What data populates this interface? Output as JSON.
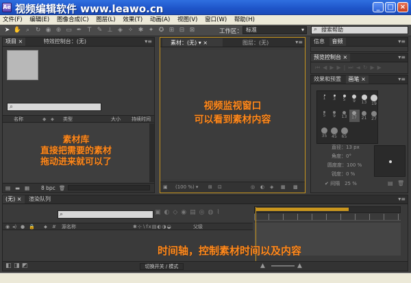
{
  "window": {
    "title": "视频编辑软件 www.leawo.cn",
    "icon_text": "Ae",
    "controls": {
      "minimize": "_",
      "maximize": "□",
      "close": "×"
    }
  },
  "menu": [
    "文件(F)",
    "编辑(E)",
    "图像合成(C)",
    "图层(L)",
    "效果(T)",
    "动画(A)",
    "视图(V)",
    "窗口(W)",
    "帮助(H)"
  ],
  "toolbar": {
    "workspace_label": "工作区：",
    "workspace_value": "标准",
    "search_placeholder": "搜索帮助"
  },
  "project_panel": {
    "tabs": [
      "项目",
      "特效控制台：(无)"
    ],
    "columns": [
      "名称",
      "类型",
      "大小",
      "持续时间"
    ],
    "bpc": "8 bpc",
    "overlay": [
      "素材库",
      "直接把需要的素材",
      "拖动进来就可以了"
    ]
  },
  "viewer_panel": {
    "tabs": [
      "素材：(无)",
      "图层：(无)"
    ],
    "zoom": "(100 %)",
    "overlay": [
      "视频监视窗口",
      "可以看到素材内容"
    ]
  },
  "right_panels": {
    "top_tabs": [
      "信息",
      "音频"
    ],
    "preview_tab": "预览控制台",
    "effects_tabs": [
      "效果和预置",
      "画笔"
    ],
    "brush_sizes": [
      "1",
      "3",
      "5",
      "9",
      "13",
      "19",
      "5",
      "9",
      "13",
      "17",
      "21",
      "27",
      "35",
      "45",
      "65"
    ],
    "brush_params": [
      {
        "label": "直径",
        "value": "13 px"
      },
      {
        "label": "角度",
        "value": "0°"
      },
      {
        "label": "圆度度",
        "value": "100 %"
      },
      {
        "label": "锐度",
        "value": "0 %"
      }
    ],
    "spacing_label": "间隔",
    "spacing_value": "25 %"
  },
  "timeline_panel": {
    "tabs": [
      "(无)",
      "渲染队列"
    ],
    "column_label": "源名称",
    "parent_label": "父级",
    "switch_label": "切换开关 / 模式",
    "overlay": "时间轴，控制素材时间以及内容"
  }
}
